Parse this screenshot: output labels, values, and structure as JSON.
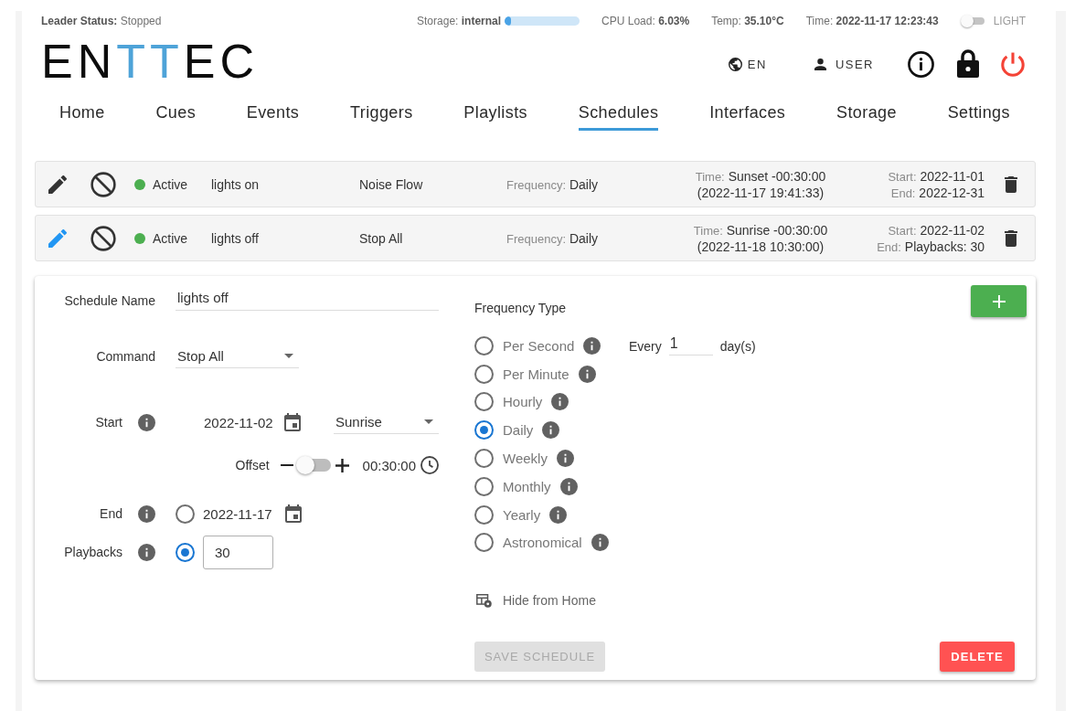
{
  "status_bar": {
    "leader_status": {
      "label": "Leader Status:",
      "value": "Stopped"
    },
    "storage": {
      "label": "Storage:",
      "value": "internal",
      "level": 0.08
    },
    "cpu_load": {
      "label": "CPU Load:",
      "value": "6.03%"
    },
    "temperature": {
      "label": "Temp:",
      "value": "35.10°C"
    },
    "time": {
      "label": "Time:",
      "value": "2022-11-17 12:23:43"
    },
    "theme_switch": {
      "label": "LIGHT",
      "on": false
    }
  },
  "header": {
    "logo": [
      {
        "text": "EN",
        "accent": false
      },
      {
        "text": "TT",
        "accent": true
      },
      {
        "text": "EC",
        "accent": false
      }
    ],
    "language": "EN",
    "user": "USER"
  },
  "tabs": [
    {
      "label": "Home",
      "selected": false
    },
    {
      "label": "Cues",
      "selected": false
    },
    {
      "label": "Events",
      "selected": false
    },
    {
      "label": "Triggers",
      "selected": false
    },
    {
      "label": "Playlists",
      "selected": false
    },
    {
      "label": "Schedules",
      "selected": true
    },
    {
      "label": "Interfaces",
      "selected": false
    },
    {
      "label": "Storage",
      "selected": false
    },
    {
      "label": "Settings",
      "selected": false
    }
  ],
  "schedules": [
    {
      "editing": false,
      "color": "#4caf50",
      "status": "Active",
      "name": "lights on",
      "command": "Noise Flow",
      "frequency_label": "Frequency:",
      "frequency": "Daily",
      "time_label": "Time:",
      "time": "Sunset -00:30:00",
      "next_time": "(2022-11-17 19:41:33)",
      "start_label": "Start:",
      "start": "2022-11-01",
      "end_label": "End:",
      "end": "2022-12-31"
    },
    {
      "editing": true,
      "color": "#4caf50",
      "status": "Active",
      "name": "lights off",
      "command": "Stop All",
      "frequency_label": "Frequency:",
      "frequency": "Daily",
      "time_label": "Time:",
      "time": "Sunrise -00:30:00",
      "next_time": "(2022-11-18 10:30:00)",
      "start_label": "Start:",
      "start": "2022-11-02",
      "end_label": "End:",
      "end": "Playbacks: 30"
    }
  ],
  "schedule_editor": {
    "name": {
      "label": "Schedule Name",
      "value": "lights off"
    },
    "command": {
      "label": "Command",
      "value": "Stop All"
    },
    "start": {
      "label": "Start",
      "date": "2022-11-02",
      "event": "Sunrise"
    },
    "offset": {
      "label": "Offset",
      "on": false,
      "value": "00:30:00"
    },
    "end": {
      "label": "End",
      "selected": false,
      "date": "2022-11-17"
    },
    "playbacks": {
      "label": "Playbacks",
      "selected": true,
      "value": "30"
    },
    "frequency_type": {
      "label": "Frequency Type",
      "options": [
        {
          "label": "Per Second",
          "selected": false
        },
        {
          "label": "Per Minute",
          "selected": false
        },
        {
          "label": "Hourly",
          "selected": false
        },
        {
          "label": "Daily",
          "selected": true
        },
        {
          "label": "Weekly",
          "selected": false
        },
        {
          "label": "Monthly",
          "selected": false
        },
        {
          "label": "Yearly",
          "selected": false
        },
        {
          "label": "Astronomical",
          "selected": false
        }
      ]
    },
    "interval": {
      "label": "Every",
      "value": "1",
      "unit": "day(s)"
    },
    "hide_from_home": {
      "label": "Hide from Home"
    },
    "save_button": {
      "label": "SAVE SCHEDULE",
      "disabled": true
    },
    "delete_button": {
      "label": "DELETE"
    }
  }
}
